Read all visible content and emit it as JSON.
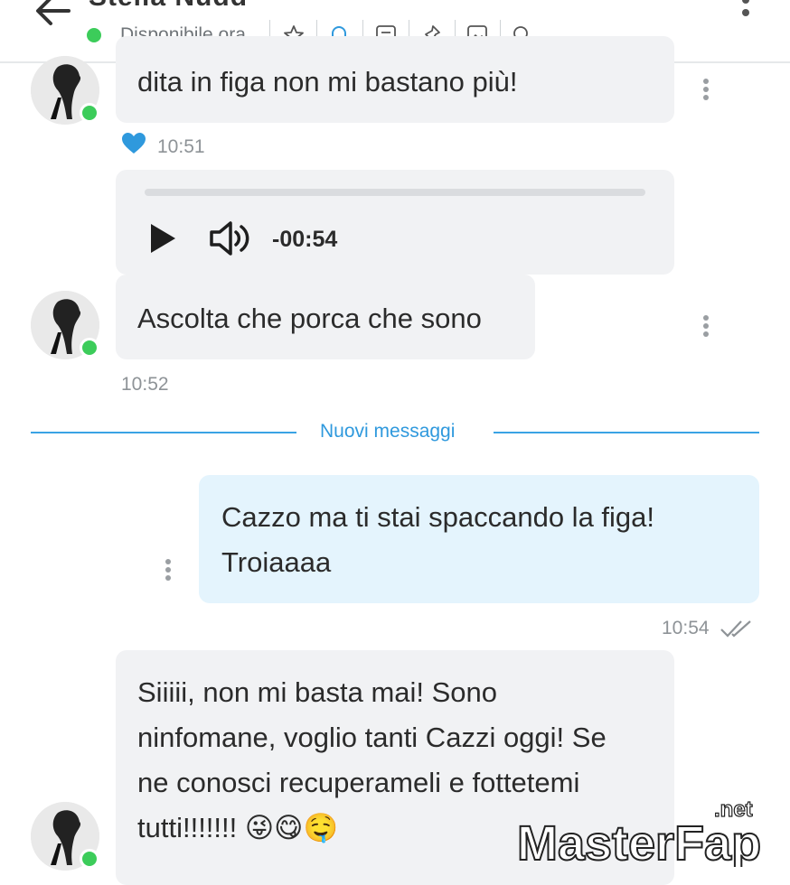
{
  "header": {
    "title": "Stella Nudd",
    "status": "Disponibile ora",
    "icons": [
      "star-icon",
      "bell-icon",
      "note-icon",
      "pin-icon",
      "image-icon",
      "search-icon"
    ]
  },
  "messages": {
    "m1": {
      "text": "dita in figa non mi bastano più!",
      "time": "10:51",
      "reaction": "heart-icon"
    },
    "audio": {
      "remaining": "-00:54"
    },
    "m2": {
      "text": "Ascolta che porca che sono",
      "time": "10:52"
    },
    "divider": "Nuovi messaggi",
    "m3": {
      "line1": "Cazzo ma ti stai spaccando la figa!",
      "line2": "Troiaaaa",
      "time": "10:54"
    },
    "m4": {
      "line1": "Siiiii, non mi basta mai! Sono",
      "line2": "ninfomane, voglio tanti Cazzi oggi! Se",
      "line3": "ne conosci recuperameli e fottetemi",
      "line4": "tutti!!!!!!! 😜😋🤤"
    }
  },
  "watermark": {
    "text": "MasterFap",
    "suffix": ".net"
  },
  "colors": {
    "accent": "#2f99dd",
    "online": "#3ccc5a",
    "incoming": "#f1f2f4",
    "outgoing": "#e4f4fd"
  }
}
